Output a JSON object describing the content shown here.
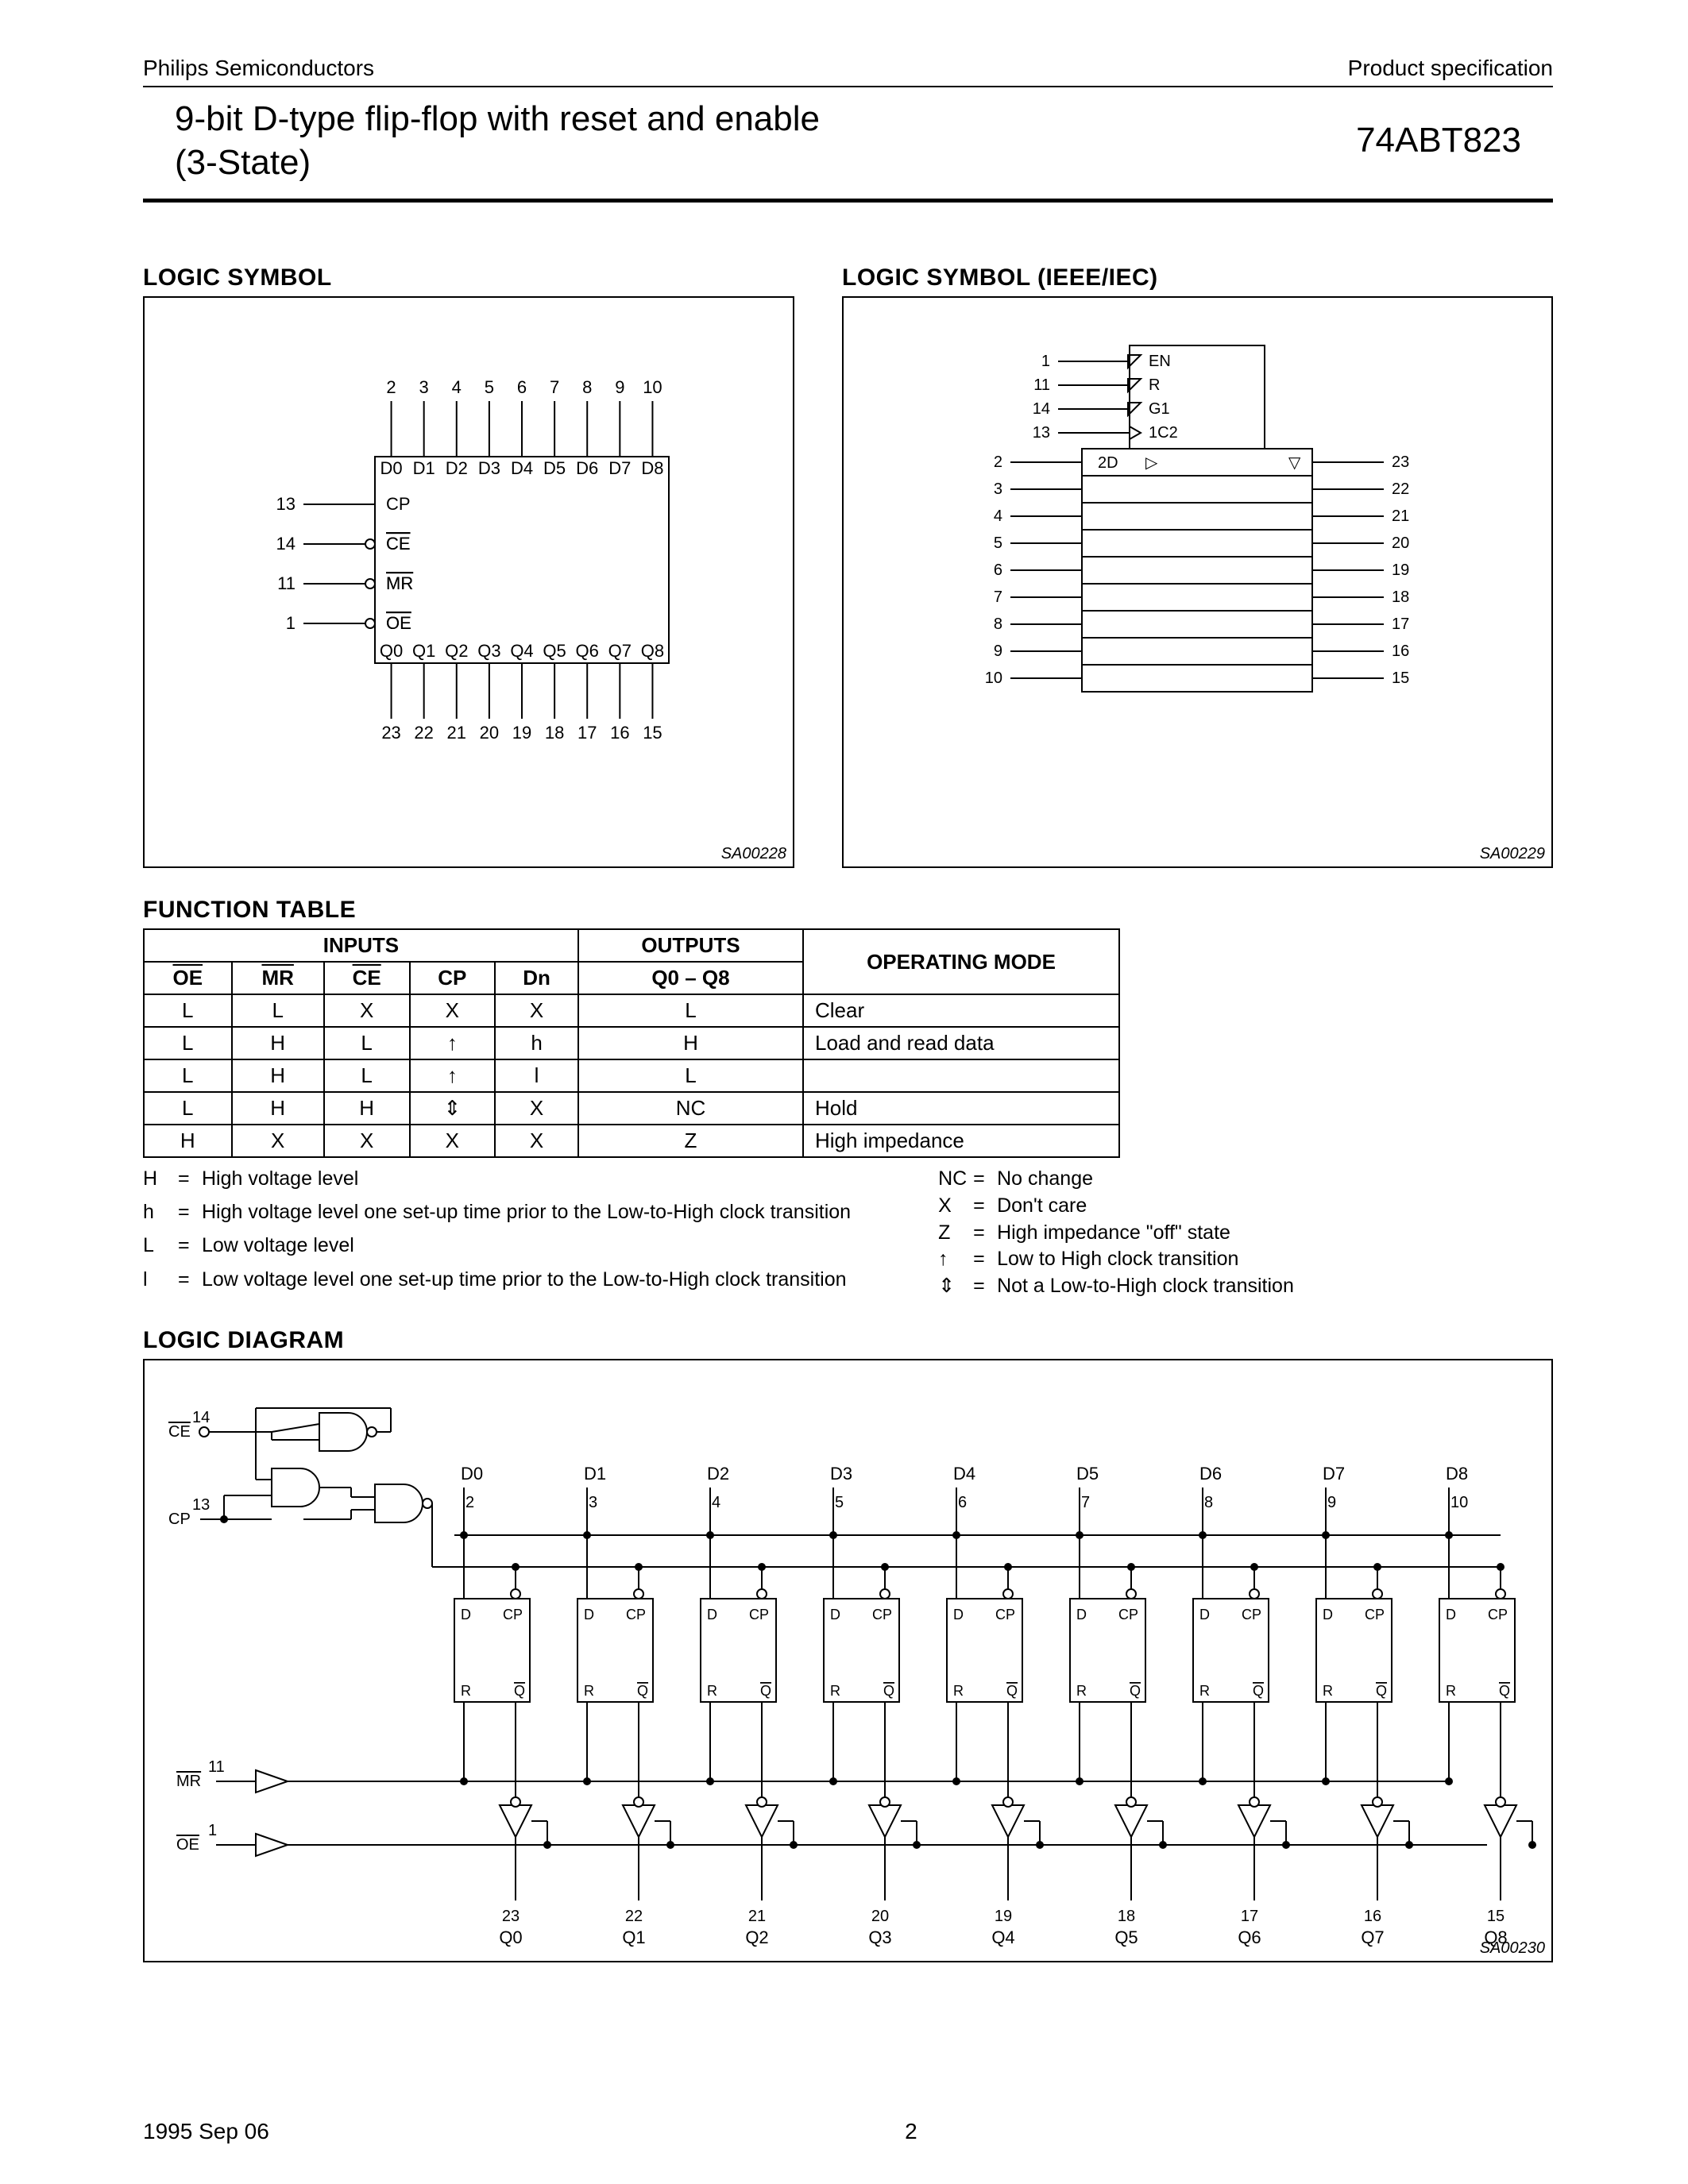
{
  "header": {
    "left": "Philips Semiconductors",
    "right": "Product specification"
  },
  "title": {
    "line1": "9-bit D-type flip-flop with reset and enable",
    "line2": "(3-State)",
    "part": "74ABT823"
  },
  "sections": {
    "logic_symbol": "LOGIC SYMBOL",
    "logic_symbol_ieee": "LOGIC SYMBOL (IEEE/IEC)",
    "function_table": "FUNCTION TABLE",
    "logic_diagram": "LOGIC DIAGRAM"
  },
  "logic_symbol": {
    "tag": "SA00228",
    "top_pins": [
      "2",
      "3",
      "4",
      "5",
      "6",
      "7",
      "8",
      "9",
      "10"
    ],
    "top_labels": [
      "D0",
      "D1",
      "D2",
      "D3",
      "D4",
      "D5",
      "D6",
      "D7",
      "D8"
    ],
    "left": [
      {
        "pin": "13",
        "label": "CP",
        "inv": false
      },
      {
        "pin": "14",
        "label": "CE",
        "inv": true
      },
      {
        "pin": "11",
        "label": "MR",
        "inv": true
      },
      {
        "pin": "1",
        "label": "OE",
        "inv": true
      }
    ],
    "bot_labels": [
      "Q0",
      "Q1",
      "Q2",
      "Q3",
      "Q4",
      "Q5",
      "Q6",
      "Q7",
      "Q8"
    ],
    "bot_pins": [
      "23",
      "22",
      "21",
      "20",
      "19",
      "18",
      "17",
      "16",
      "15"
    ]
  },
  "ieee": {
    "tag": "SA00229",
    "ctrl": [
      {
        "pin": "1",
        "label": "EN",
        "inv": true
      },
      {
        "pin": "11",
        "label": "R",
        "inv": true
      },
      {
        "pin": "14",
        "label": "G1",
        "inv": true
      },
      {
        "pin": "13",
        "label": "1C2",
        "clk": true
      }
    ],
    "rows": [
      {
        "l": "2",
        "r": "23"
      },
      {
        "l": "3",
        "r": "22"
      },
      {
        "l": "4",
        "r": "21"
      },
      {
        "l": "5",
        "r": "20"
      },
      {
        "l": "6",
        "r": "19"
      },
      {
        "l": "7",
        "r": "18"
      },
      {
        "l": "8",
        "r": "17"
      },
      {
        "l": "9",
        "r": "16"
      },
      {
        "l": "10",
        "r": "15"
      }
    ],
    "cell_label": "2D"
  },
  "ft": {
    "group_inputs": "INPUTS",
    "group_outputs": "OUTPUTS",
    "group_mode": "OPERATING MODE",
    "cols": [
      "OE",
      "MR",
      "CE",
      "CP",
      "Dn",
      "Q0 – Q8"
    ],
    "rows": [
      {
        "c": [
          "L",
          "L",
          "X",
          "X",
          "X",
          "L"
        ],
        "mode": "Clear"
      },
      {
        "c": [
          "L",
          "H",
          "L",
          "↑",
          "h",
          "H"
        ],
        "mode": "Load and read data"
      },
      {
        "c": [
          "L",
          "H",
          "L",
          "↑",
          "l",
          "L"
        ],
        "mode": ""
      },
      {
        "c": [
          "L",
          "H",
          "H",
          "⇕",
          "X",
          "NC"
        ],
        "mode": "Hold"
      },
      {
        "c": [
          "H",
          "X",
          "X",
          "X",
          "X",
          "Z"
        ],
        "mode": "High impedance"
      }
    ]
  },
  "legend": {
    "left": [
      {
        "s": "H",
        "d": "High voltage level"
      },
      {
        "s": "h",
        "d": "High voltage level one set-up time prior to the Low-to-High clock transition"
      },
      {
        "s": "L",
        "d": "Low voltage level"
      },
      {
        "s": "l",
        "d": "Low voltage level one set-up time prior to the Low-to-High clock transition"
      }
    ],
    "right": [
      {
        "s": "NC",
        "d": "No change"
      },
      {
        "s": "X",
        "d": "Don't care"
      },
      {
        "s": "Z",
        "d": "High impedance \"off\" state"
      },
      {
        "s": "↑",
        "d": "Low to High clock transition"
      },
      {
        "s": "⇕",
        "d": "Not a Low-to-High clock transition"
      }
    ]
  },
  "logic_diagram": {
    "tag": "SA00230",
    "inputs": [
      {
        "pin": "14",
        "label": "CE"
      },
      {
        "pin": "13",
        "label": "CP"
      },
      {
        "pin": "11",
        "label": "MR"
      },
      {
        "pin": "1",
        "label": "OE"
      }
    ],
    "d": [
      {
        "lbl": "D0",
        "pin": "2"
      },
      {
        "lbl": "D1",
        "pin": "3"
      },
      {
        "lbl": "D2",
        "pin": "4"
      },
      {
        "lbl": "D3",
        "pin": "5"
      },
      {
        "lbl": "D4",
        "pin": "6"
      },
      {
        "lbl": "D5",
        "pin": "7"
      },
      {
        "lbl": "D6",
        "pin": "8"
      },
      {
        "lbl": "D7",
        "pin": "9"
      },
      {
        "lbl": "D8",
        "pin": "10"
      }
    ],
    "q": [
      {
        "lbl": "Q0",
        "pin": "23"
      },
      {
        "lbl": "Q1",
        "pin": "22"
      },
      {
        "lbl": "Q2",
        "pin": "21"
      },
      {
        "lbl": "Q3",
        "pin": "20"
      },
      {
        "lbl": "Q4",
        "pin": "19"
      },
      {
        "lbl": "Q5",
        "pin": "18"
      },
      {
        "lbl": "Q6",
        "pin": "17"
      },
      {
        "lbl": "Q7",
        "pin": "16"
      },
      {
        "lbl": "Q8",
        "pin": "15"
      }
    ],
    "ff": {
      "D": "D",
      "CP": "CP",
      "R": "R",
      "Q": "Q"
    }
  },
  "footer": {
    "date": "1995 Sep 06",
    "page": "2"
  }
}
